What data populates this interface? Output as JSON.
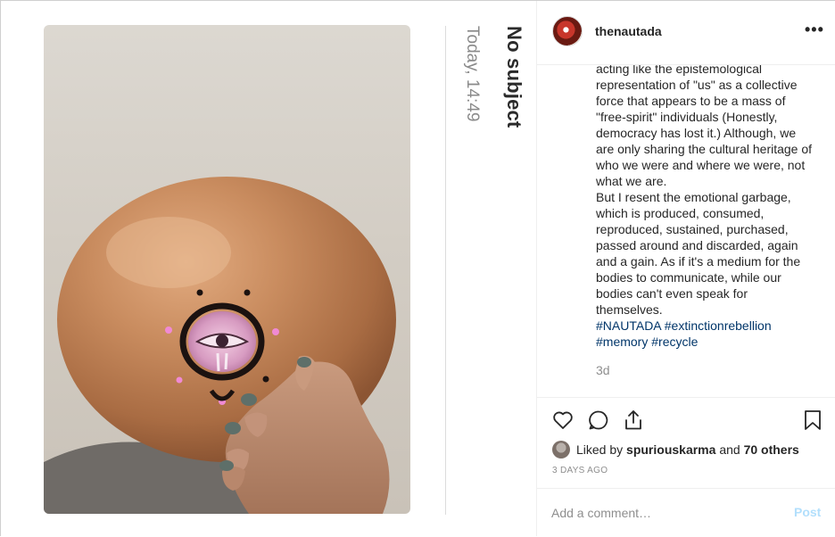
{
  "mail": {
    "subject": "No subject",
    "time": "Today, 14:49"
  },
  "post": {
    "username": "thenautada",
    "more_label": "•••",
    "caption_lines": [
      "acting like the epistemological",
      "representation of \"us\" as a collective",
      "force that appears to be a mass of",
      "\"free-spirit\" individuals (Honestly,",
      "democracy has lost it.) Although, we",
      "are only sharing the cultural heritage of",
      "who we were and where we were, not",
      "what we are.",
      "But I resent the emotional garbage,",
      "which is produced, consumed,",
      "reproduced, sustained, purchased,",
      "passed around and discarded, again",
      "and a gain. As if it's a medium for the",
      "bodies to communicate, while our",
      "bodies can't even speak for",
      "themselves."
    ],
    "hashtags_line1": [
      "#NAUTADA",
      "#extinctionrebellion"
    ],
    "hashtags_line2": [
      "#memory",
      "#recycle"
    ],
    "age": "3d",
    "likes": {
      "prefix": "Liked by",
      "user": "spuriouskarma",
      "and": "and",
      "others": "70 others"
    },
    "timestamp": "3 DAYS AGO",
    "comment_placeholder": "Add a comment…",
    "post_label": "Post"
  },
  "icons": [
    "heart-icon",
    "comment-icon",
    "share-icon",
    "bookmark-icon",
    "more-options-icon"
  ],
  "colors": {
    "hashtag": "#003569",
    "post_button_disabled": "#b2dffc",
    "muted_text": "#8e8e8e",
    "balloon": "#c4875a"
  }
}
